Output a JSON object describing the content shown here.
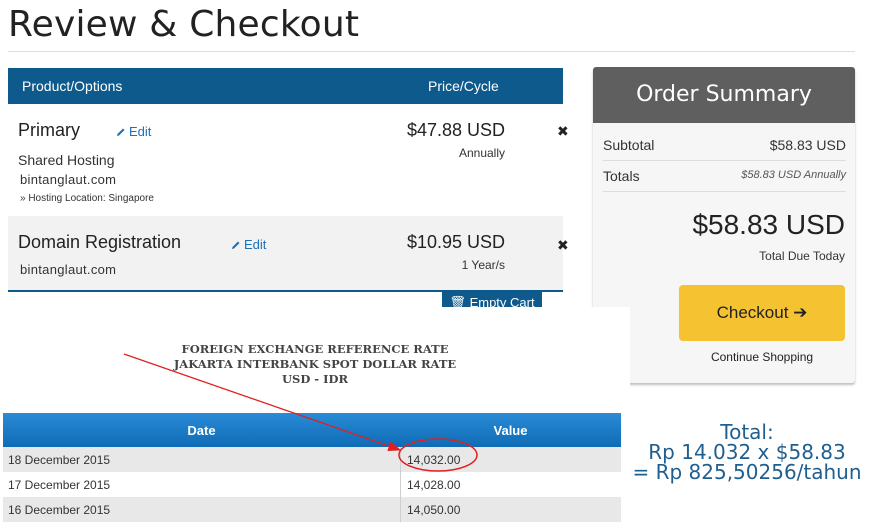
{
  "page": {
    "title": "Review & Checkout"
  },
  "cart": {
    "header": {
      "product_col": "Product/Options",
      "price_col": "Price/Cycle"
    },
    "items": [
      {
        "name": "Primary",
        "edit": "Edit",
        "subtitle": "Shared Hosting",
        "domain": "bintanglaut.com",
        "option": "» Hosting Location: Singapore",
        "price": "$47.88 USD",
        "cycle": "Annually"
      },
      {
        "name": "Domain Registration",
        "edit": "Edit",
        "domain": "bintanglaut.com",
        "price": "$10.95 USD",
        "cycle": "1 Year/s"
      }
    ],
    "empty_cart": "Empty Cart"
  },
  "summary": {
    "title": "Order Summary",
    "subtotal_label": "Subtotal",
    "subtotal_value": "$58.83 USD",
    "totals_label": "Totals",
    "totals_value": "$58.83 USD Annually",
    "total_due": "$58.83 USD",
    "total_due_label": "Total Due Today",
    "checkout": "Checkout",
    "continue": "Continue Shopping"
  },
  "fx": {
    "heading_line1": "FOREIGN EXCHANGE REFERENCE RATE",
    "heading_line2": "JAKARTA INTERBANK SPOT DOLLAR RATE",
    "heading_line3": "USD - IDR",
    "col_date": "Date",
    "col_value": "Value",
    "rows": [
      {
        "date": "18 December 2015",
        "value": "14,032.00"
      },
      {
        "date": "17 December 2015",
        "value": "14,028.00"
      },
      {
        "date": "16 December 2015",
        "value": "14,050.00"
      }
    ]
  },
  "annotation": {
    "line1": "Total:",
    "line2": "Rp 14.032 x $58.83",
    "line3": "= Rp 825,50256/tahun",
    "color": "#e02020"
  },
  "colors": {
    "primary": "#0e5a8c",
    "checkout": "#f5c332",
    "summary_header": "#5f5f5f"
  }
}
